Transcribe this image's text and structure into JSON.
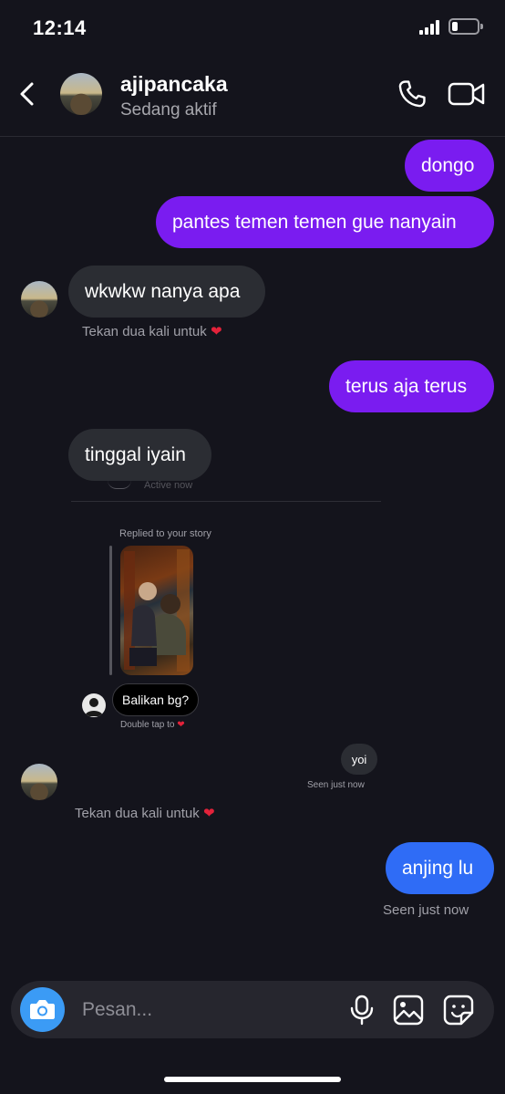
{
  "status_bar": {
    "time": "12:14"
  },
  "header": {
    "name": "ajipancaka",
    "status": "Sedang aktif"
  },
  "messages": {
    "m1": "dongo",
    "m2": "pantes temen temen gue nanyain",
    "m3": "wkwkw nanya apa",
    "m3_hint": "Tekan dua kali untuk",
    "m4": "terus aja terus",
    "m5": "tinggal iyain"
  },
  "embedded": {
    "ghost_text": "Active now",
    "replied_label": "Replied to your story",
    "reply_text": "Balikan bg?",
    "reply_hint": "Double tap to",
    "yoi": "yoi",
    "seen_small": "Seen just now"
  },
  "after": {
    "hint": "Tekan dua kali untuk",
    "m6": "anjing lu",
    "seen": "Seen just now"
  },
  "composer": {
    "placeholder": "Pesan..."
  },
  "colors": {
    "purple_bubble": "#7a1cf0",
    "blue_bubble": "#2f6cf6",
    "incoming_bubble": "#2b2d33",
    "camera": "#3b9bf5",
    "heart": "#e3223a"
  }
}
